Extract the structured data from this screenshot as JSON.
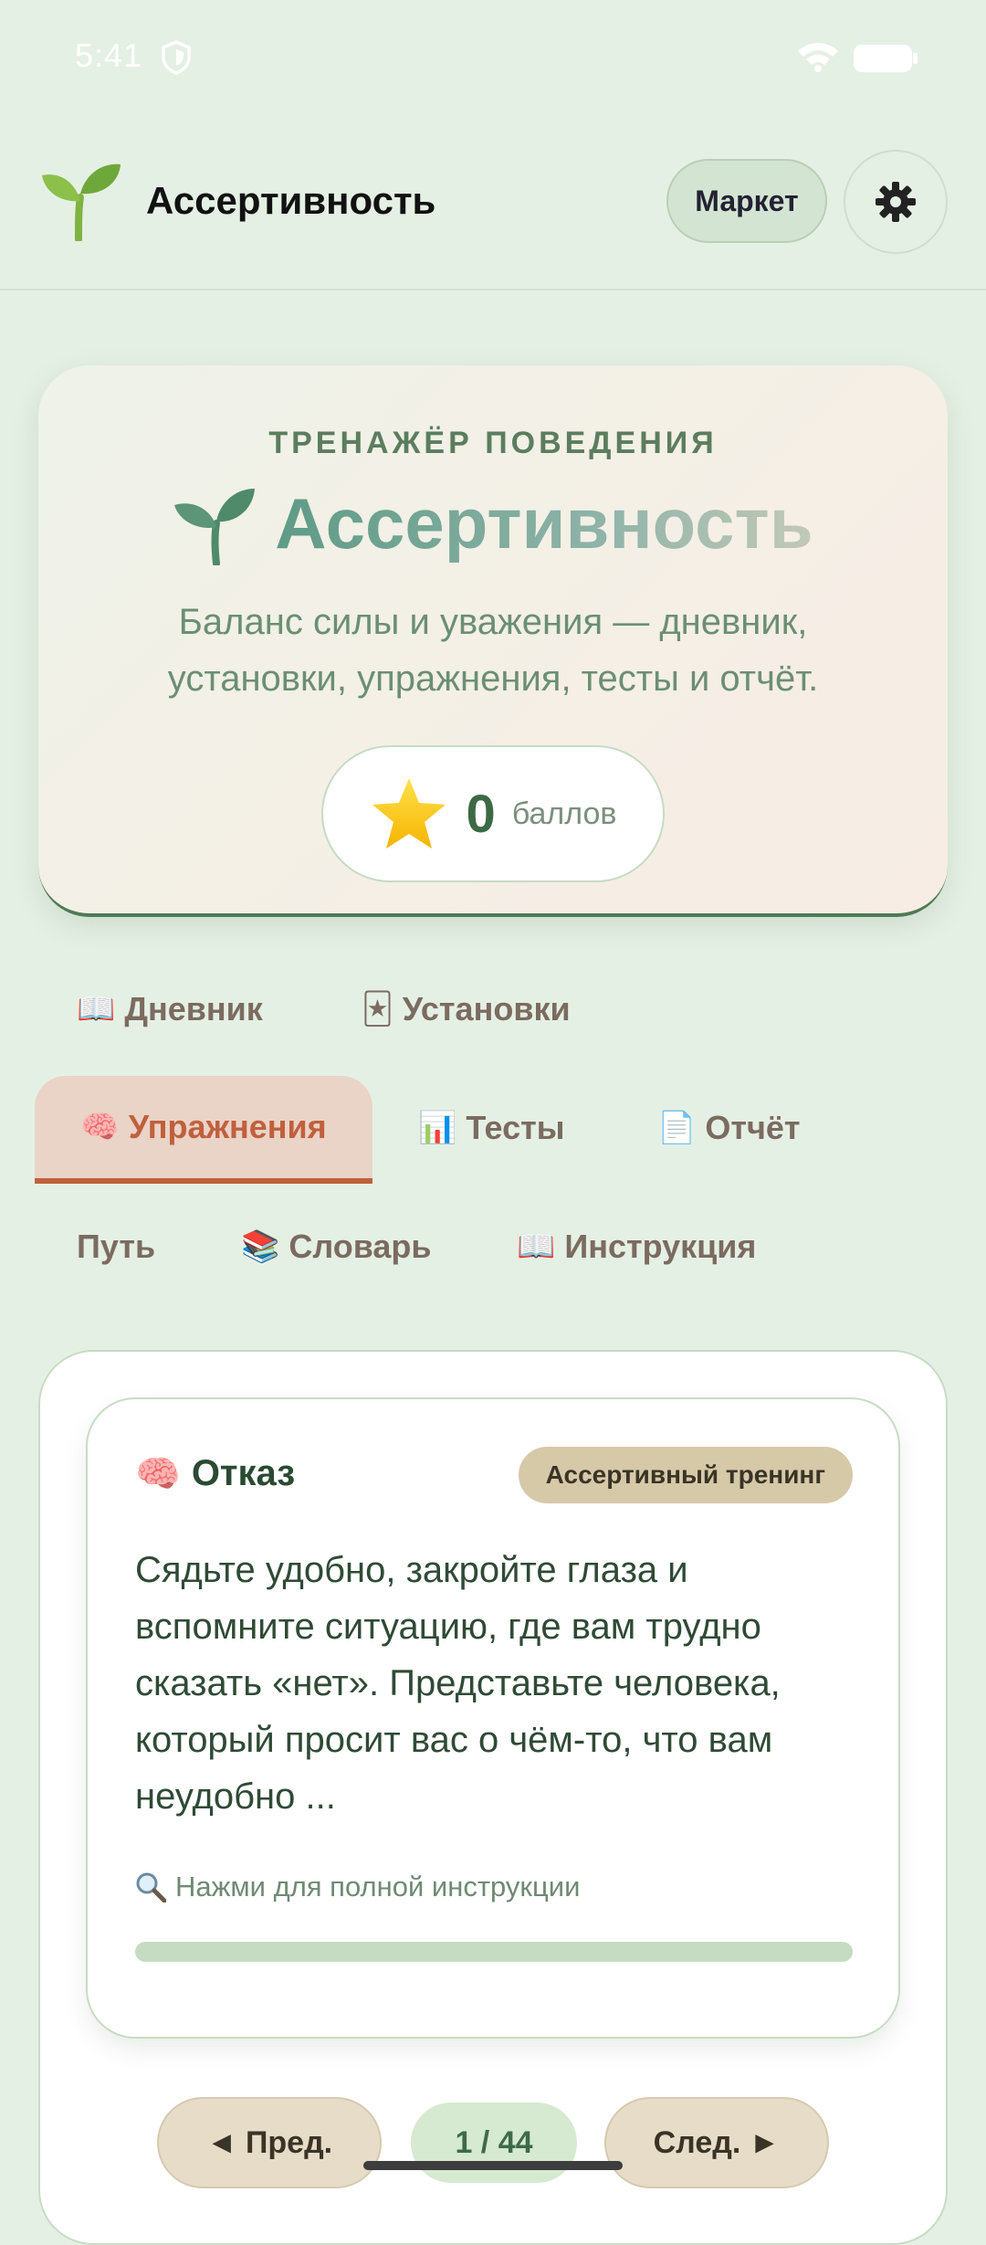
{
  "status_bar": {
    "time": "5:41"
  },
  "header": {
    "title": "Ассертивность",
    "market_label": "Маркет",
    "logo_icon": "sprout-icon",
    "settings_icon": "gear-icon"
  },
  "hero": {
    "overline": "ТРЕНАЖЁР ПОВЕДЕНИЯ",
    "title": "Ассертивность",
    "subtitle": "Баланс силы и уважения — дневник, установки, упражнения, тесты и отчёт.",
    "points_value": "0",
    "points_label": "баллов"
  },
  "tabs": [
    {
      "emoji": "📖",
      "label": "Дневник",
      "active": false
    },
    {
      "emoji": "🃏",
      "label": "Установки",
      "active": false
    },
    {
      "emoji": "🧠",
      "label": "Упражнения",
      "active": true
    },
    {
      "emoji": "📊",
      "label": "Тесты",
      "active": false
    },
    {
      "emoji": "📄",
      "label": "Отчёт",
      "active": false
    },
    {
      "emoji": "",
      "label": "Путь",
      "active": false
    },
    {
      "emoji": "📚",
      "label": "Словарь",
      "active": false
    },
    {
      "emoji": "📖",
      "label": "Инструкция",
      "active": false
    }
  ],
  "exercise": {
    "emoji": "🧠",
    "title": "Отказ",
    "category": "Ассертивный тренинг",
    "text": "Сядьте удобно, закройте глаза и вспомните ситуацию, где вам трудно сказать «нет». Представьте человека, который просит вас о чём-то, что вам неудобно ...",
    "hint": "Нажми для полной инструкции",
    "progress": 0
  },
  "pagination": {
    "prev_label": "◄ Пред.",
    "page": "1 / 44",
    "next_label": "След. ►"
  },
  "colors": {
    "background": "#e5f0e4",
    "accent_green": "#4d7a55",
    "active_tab": "#c0603c",
    "badge": "#d6c9a8"
  }
}
